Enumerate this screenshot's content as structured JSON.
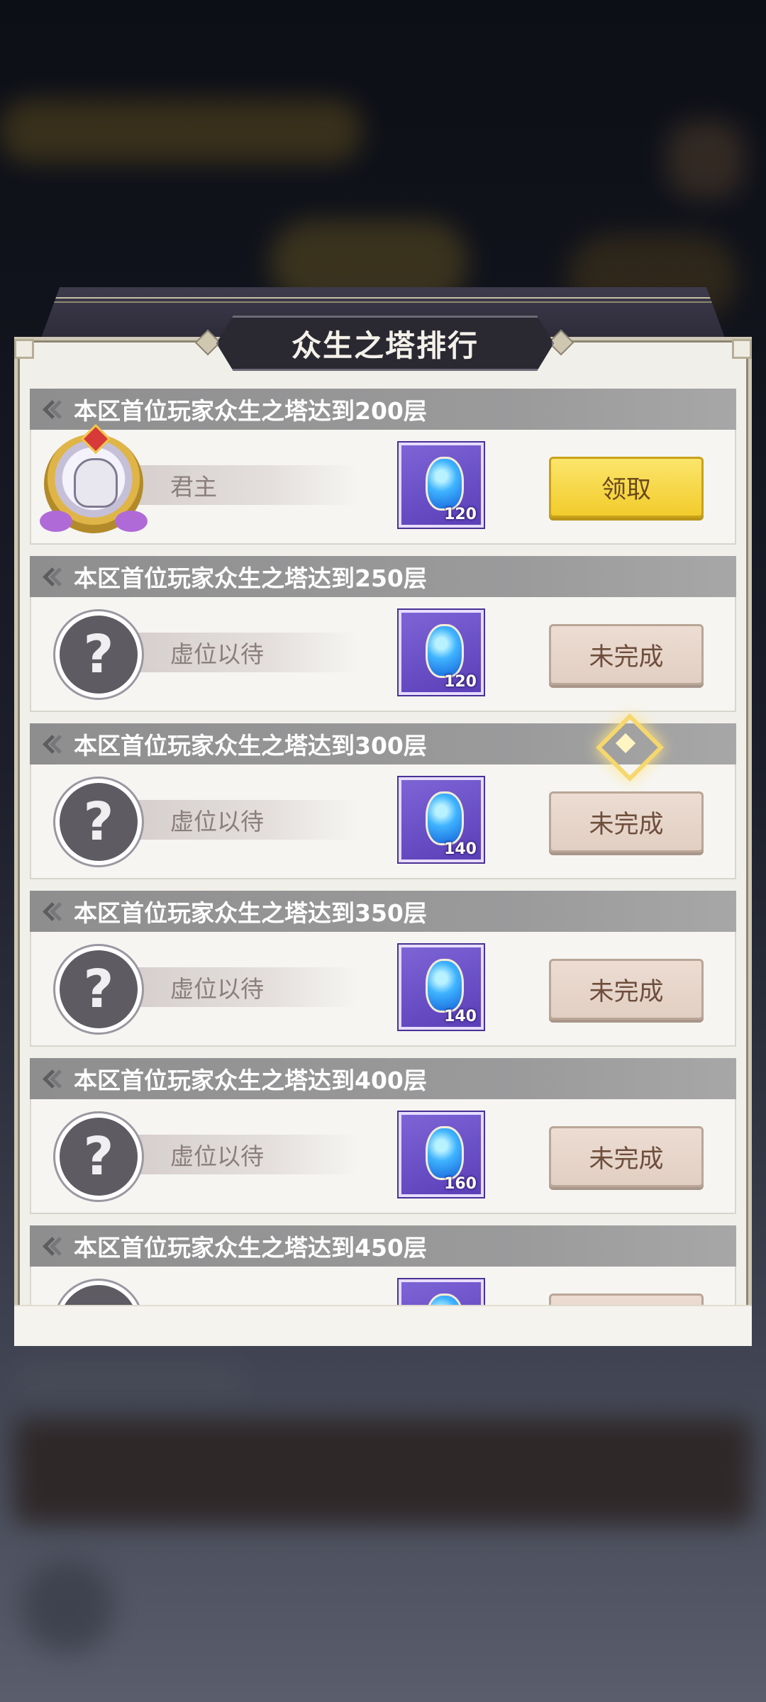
{
  "title": "众生之塔排行",
  "ranks": [
    {
      "label": "本区首位玩家众生之塔达到200层",
      "player": "君主",
      "has_player": true,
      "reward_count": "120",
      "button": "领取",
      "claimable": true
    },
    {
      "label": "本区首位玩家众生之塔达到250层",
      "player": "虚位以待",
      "has_player": false,
      "reward_count": "120",
      "button": "未完成",
      "claimable": false
    },
    {
      "label": "本区首位玩家众生之塔达到300层",
      "player": "虚位以待",
      "has_player": false,
      "reward_count": "140",
      "button": "未完成",
      "claimable": false
    },
    {
      "label": "本区首位玩家众生之塔达到350层",
      "player": "虚位以待",
      "has_player": false,
      "reward_count": "140",
      "button": "未完成",
      "claimable": false
    },
    {
      "label": "本区首位玩家众生之塔达到400层",
      "player": "虚位以待",
      "has_player": false,
      "reward_count": "160",
      "button": "未完成",
      "claimable": false
    },
    {
      "label": "本区首位玩家众生之塔达到450层",
      "player": "",
      "has_player": false,
      "reward_count": "",
      "button": "",
      "claimable": false
    }
  ],
  "placeholder_avatar_symbol": "?",
  "icons": {
    "header": "double-chevron-icon",
    "reward": "blue-crystal-icon",
    "avatar": "question-mark-icon"
  },
  "colors": {
    "claim_button": "#f2cc2c",
    "pending_button": "#e2cfc3",
    "header_bar": "#9b9b9c",
    "reward_frame": "#6a50c8"
  }
}
